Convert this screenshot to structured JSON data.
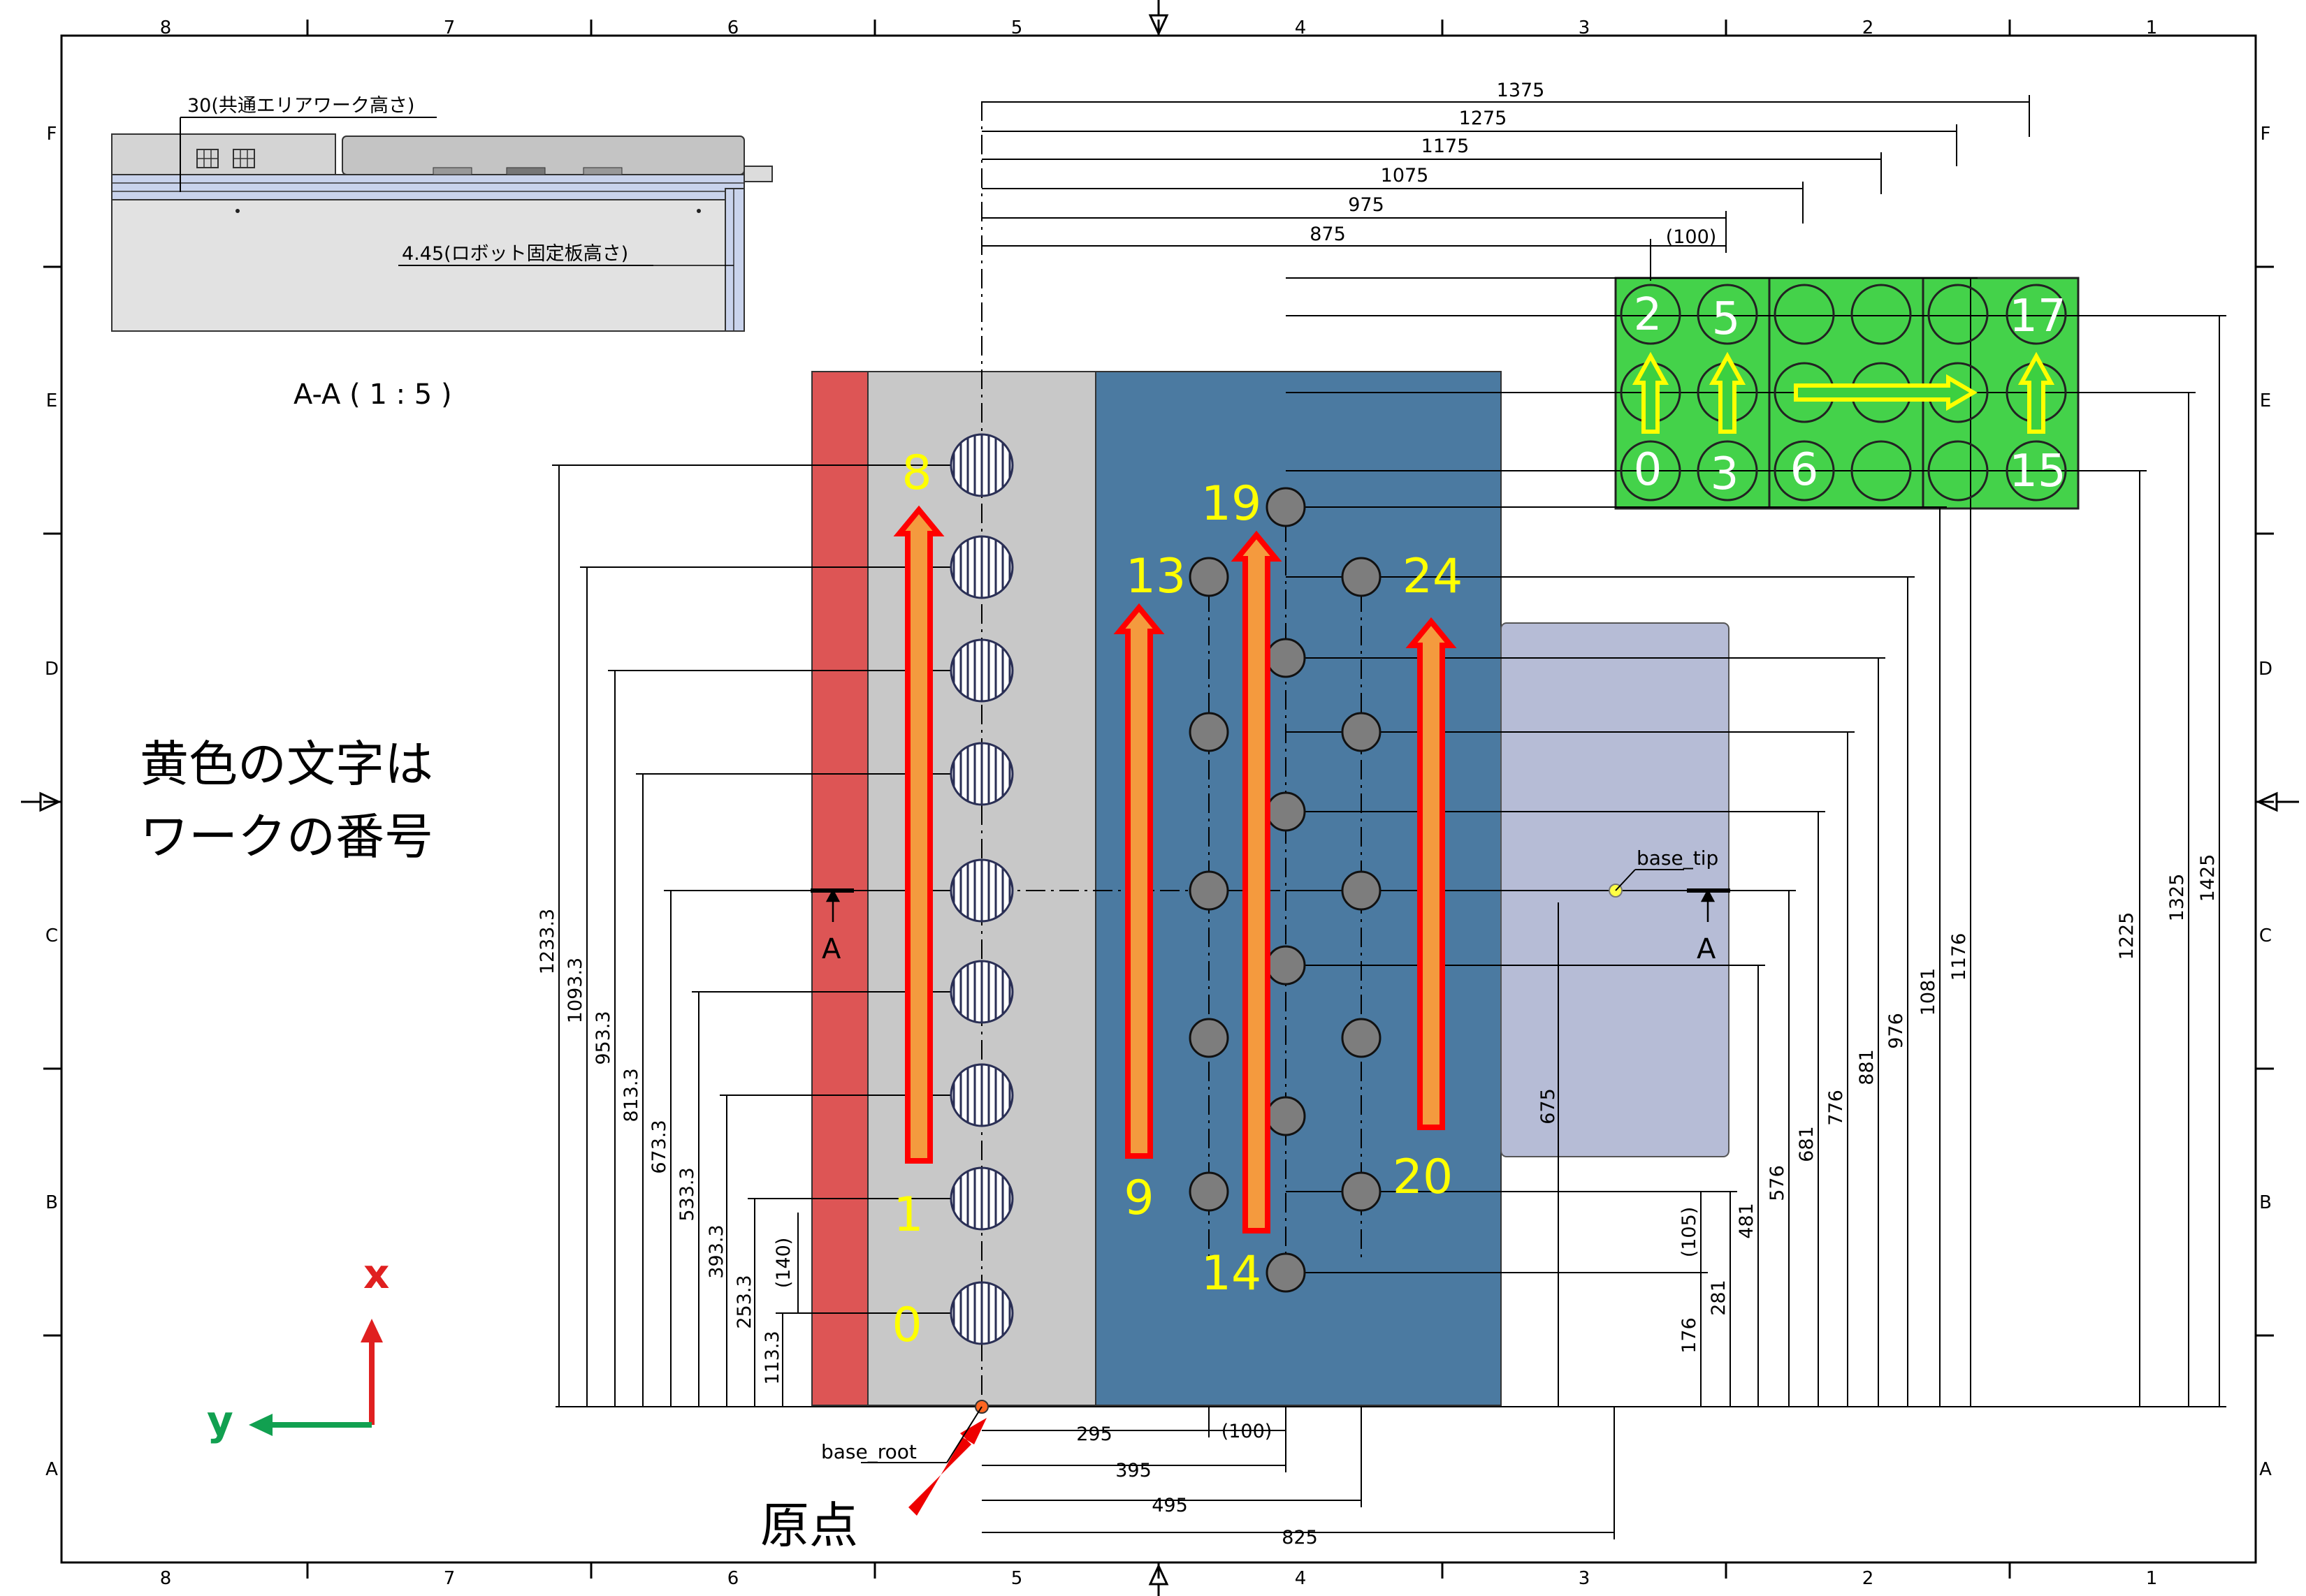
{
  "frame": {
    "columns": [
      "8",
      "7",
      "6",
      "5",
      "4",
      "3",
      "2",
      "1"
    ],
    "rows": [
      "F",
      "E",
      "D",
      "C",
      "B",
      "A"
    ]
  },
  "section": {
    "label_work_height": "30(共通エリアワーク高さ)",
    "label_robot_plate": "4.45(ロボット固定板高さ)",
    "title": "A-A ( 1 : 5 )"
  },
  "note": {
    "line1": "黄色の文字は",
    "line2": "ワークの番号"
  },
  "origin_label": "原点",
  "points": {
    "base_root": "base_root",
    "base_tip": "base_tip"
  },
  "cut_marker": "A",
  "axes": {
    "x": "x",
    "y": "y"
  },
  "top_dims": [
    "1375",
    "1275",
    "1175",
    "1075",
    "975",
    "875",
    "(100)"
  ],
  "left_dims": [
    "1233.3",
    "1093.3",
    "953.3",
    "813.3",
    "673.3",
    "533.3",
    "393.3",
    "253.3",
    "113.3",
    "(140)"
  ],
  "right_dims": [
    "1425",
    "1325",
    "1225",
    "1176",
    "1081",
    "976",
    "881",
    "776",
    "681",
    "576",
    "481",
    "281",
    "176",
    "(105)",
    "675"
  ],
  "bottom_dims": [
    "295",
    "(100)",
    "395",
    "495",
    "825"
  ],
  "work_numbers": {
    "n0": "0",
    "n1": "1",
    "n8": "8",
    "n9": "9",
    "n13": "13",
    "n14": "14",
    "n19": "19",
    "n20": "20",
    "n24": "24",
    "g2": "2",
    "g5": "5",
    "g0": "0",
    "g3": "3",
    "g6": "6",
    "g17": "17",
    "g15": "15"
  },
  "colors": {
    "red_bar": "#dd5555",
    "grey_plate": "#c8c8c8",
    "blue_plate": "#4b7aa1",
    "lavender_plate": "#b6bcd6",
    "green_tray": "#44d24a",
    "work_label": "#ffff00",
    "arrow_fill": "#f49a3e",
    "arrow_outline": "#ff0000",
    "axis_x": "#e02020",
    "axis_y": "#11a050"
  }
}
